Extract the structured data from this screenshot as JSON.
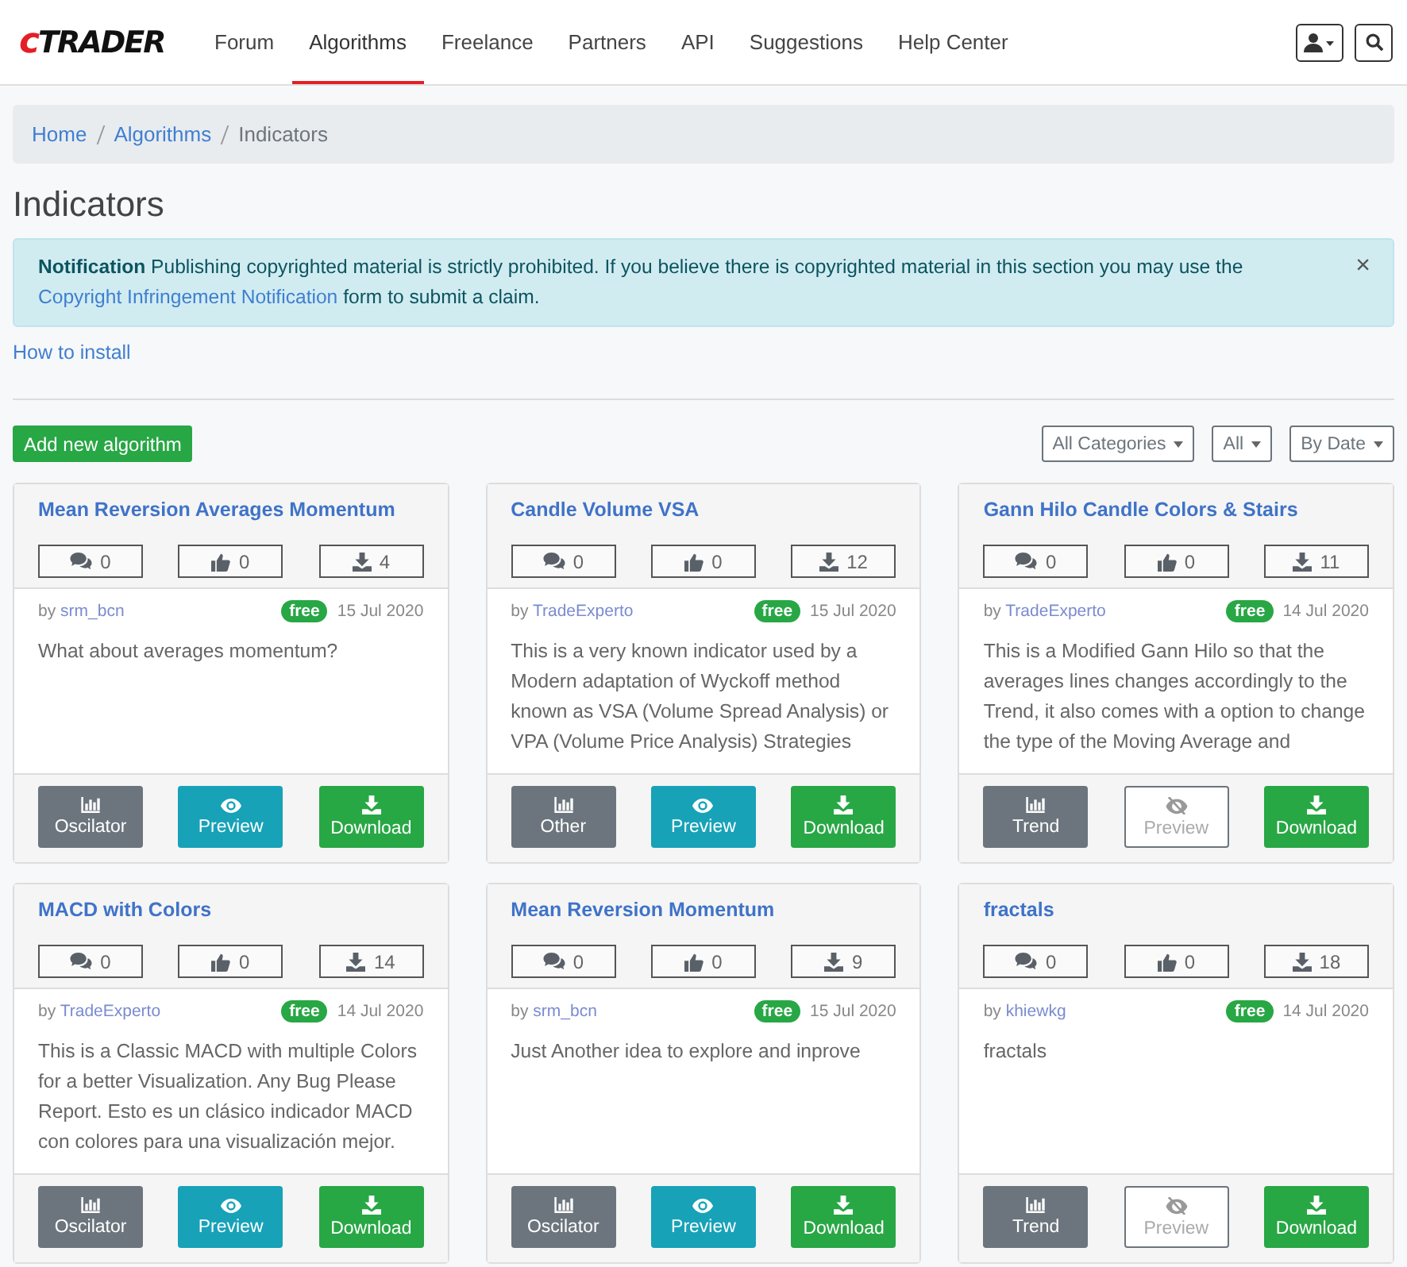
{
  "navbar": {
    "logo": {
      "prefix": "c",
      "main": "TRADER"
    },
    "links": [
      {
        "label": "Forum",
        "selected": false
      },
      {
        "label": "Algorithms",
        "selected": true
      },
      {
        "label": "Freelance",
        "selected": false
      },
      {
        "label": "Partners",
        "selected": false
      },
      {
        "label": "API",
        "selected": false
      },
      {
        "label": "Suggestions",
        "selected": false
      },
      {
        "label": "Help Center",
        "selected": false
      }
    ]
  },
  "breadcrumb": [
    {
      "label": "Home",
      "link": true
    },
    {
      "label": "Algorithms",
      "link": true
    },
    {
      "label": "Indicators",
      "link": false
    }
  ],
  "title": "Indicators",
  "notification": {
    "text_before": "**Notification** Publishing copyrighted material is strictly prohibited. If you believe there is copyrighted material in this section you may use the",
    "link": "Copyright Infringement Notification",
    "text_after": "form to submit a claim.",
    "close": "×"
  },
  "how_to_install": "How to install",
  "add_button": "Add new algorithm",
  "filters": [
    "All Categories",
    "All",
    "By Date"
  ],
  "cards": [
    {
      "title": "Mean Reversion Averages Momentum",
      "comments": "0",
      "likes": "0",
      "downloads": "4",
      "by_label": "by",
      "author": "srm_bcn",
      "badge": "free",
      "date": "15 Jul 2020",
      "description": "What about averages momentum?",
      "category": "Oscilator",
      "preview": "Preview",
      "preview_available": true,
      "download": "Download"
    },
    {
      "title": "Candle Volume VSA",
      "comments": "0",
      "likes": "0",
      "downloads": "12",
      "by_label": "by",
      "author": "TradeExperto",
      "badge": "free",
      "date": "15 Jul 2020",
      "description": "This is a very known indicator used by a Modern adaptation of Wyckoff method known as VSA (Volume Spread Analysis) or VPA (Volume Price Analysis) Strategies",
      "category": "Other",
      "preview": "Preview",
      "preview_available": true,
      "download": "Download"
    },
    {
      "title": "Gann Hilo Candle Colors & Stairs",
      "comments": "0",
      "likes": "0",
      "downloads": "11",
      "by_label": "by",
      "author": "TradeExperto",
      "badge": "free",
      "date": "14 Jul 2020",
      "description": "This is a Modified Gann Hilo so that the averages lines changes accordingly to the Trend, it also comes with a option to change the type of the Moving Average and",
      "category": "Trend",
      "preview": "Preview",
      "preview_available": false,
      "download": "Download"
    },
    {
      "title": "MACD with Colors",
      "comments": "0",
      "likes": "0",
      "downloads": "14",
      "by_label": "by",
      "author": "TradeExperto",
      "badge": "free",
      "date": "14 Jul 2020",
      "description": "This is a Classic MACD with multiple Colors for a better Visualization. Any Bug Please Report. Esto es un clásico indicador MACD con colores para una visualización mejor.",
      "category": "Oscilator",
      "preview": "Preview",
      "preview_available": true,
      "download": "Download"
    },
    {
      "title": "Mean Reversion Momentum",
      "comments": "0",
      "likes": "0",
      "downloads": "9",
      "by_label": "by",
      "author": "srm_bcn",
      "badge": "free",
      "date": "15 Jul 2020",
      "description": "Just Another idea to explore and inprove",
      "category": "Oscilator",
      "preview": "Preview",
      "preview_available": true,
      "download": "Download"
    },
    {
      "title": "fractals",
      "comments": "0",
      "likes": "0",
      "downloads": "18",
      "by_label": "by",
      "author": "khiewkg",
      "badge": "free",
      "date": "14 Jul 2020",
      "description": "fractals",
      "category": "Trend",
      "preview": "Preview",
      "preview_available": false,
      "download": "Download"
    }
  ]
}
